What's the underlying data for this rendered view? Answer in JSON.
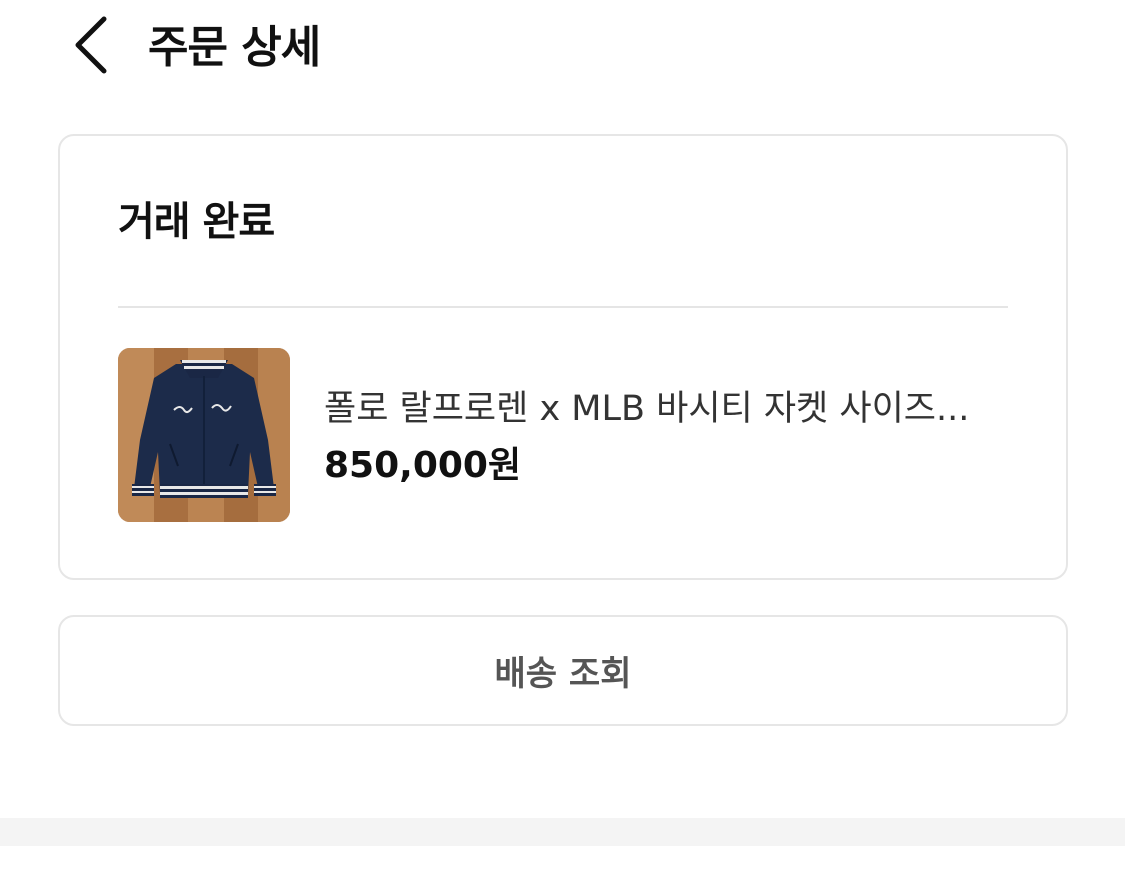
{
  "header": {
    "back_icon": "chevron-left-icon",
    "title": "주문 상세"
  },
  "order": {
    "status": "거래 완료",
    "product": {
      "thumbnail": "navy varsity jacket photo",
      "name": "폴로 랄프로렌 x MLB 바시티 자켓 사이즈...",
      "price": "850,000원"
    }
  },
  "actions": {
    "shipping_label": "배송 조회"
  },
  "colors": {
    "text_primary": "#111111",
    "text_secondary": "#333333",
    "button_text": "#555555",
    "border": "#e6e6e6",
    "background_band": "#f4f4f4"
  }
}
